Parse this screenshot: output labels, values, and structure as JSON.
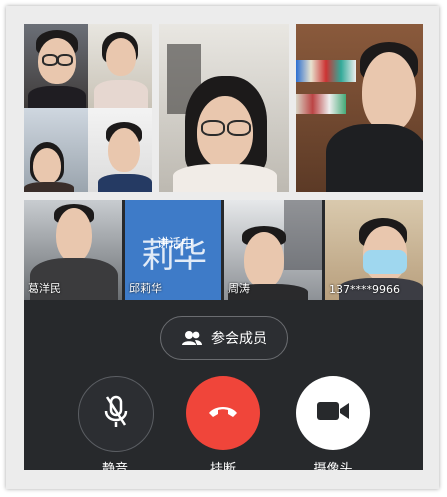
{
  "meeting": {
    "members_button_label": "参会成员",
    "speaking_label": "讲话中",
    "participants": [
      {
        "name": "葛洋民"
      },
      {
        "name": "邱莉华",
        "avatar_text": "莉华"
      },
      {
        "name": "周涛"
      },
      {
        "name": "137****9966"
      }
    ],
    "controls": {
      "mute_label": "静音",
      "hangup_label": "挂断",
      "camera_label": "摄像头"
    }
  },
  "colors": {
    "hangup": "#f0453a",
    "avatar_bg": "#3e7bc8",
    "panel_bg": "#27292c"
  }
}
